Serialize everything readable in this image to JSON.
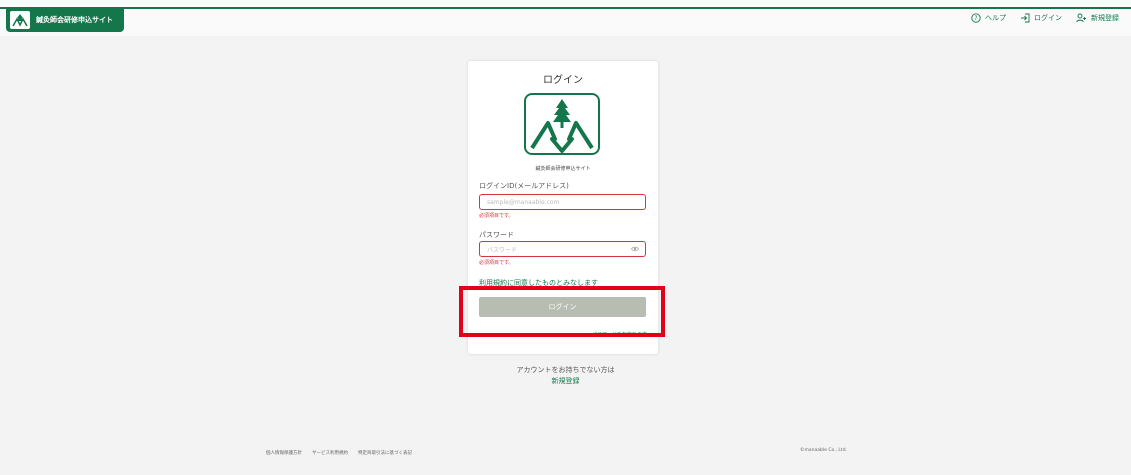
{
  "header": {
    "site_title": "鍼灸師会研修申込サイト",
    "nav": {
      "help": "ヘルプ",
      "login": "ログイン",
      "signup": "新規登録"
    }
  },
  "card": {
    "title": "ログイン",
    "site_name": "鍼灸師会研修申込サイト",
    "login_id_label": "ログインID(メールアドレス)",
    "login_id_placeholder": "sample@manaable.com",
    "login_id_error": "必須項目です。",
    "password_label": "パスワード",
    "password_placeholder": "パスワード",
    "password_error": "必須項目です。",
    "terms_text": "利用規約に同意したものとみなします",
    "login_button": "ログイン",
    "forgot_password": "パスワードをお忘れの方"
  },
  "below_card": {
    "no_account_text": "アカウントをお持ちでない方は",
    "signup_link": "新規登録"
  },
  "footer": {
    "links": [
      "個人情報保護方針",
      "サービス利用規約",
      "特定商取引法に基づく表記"
    ],
    "copyright": "©manaable Co., Ltd."
  },
  "colors": {
    "brand": "#14774c",
    "error": "#d9333f",
    "highlight": "#e3001b",
    "button_disabled": "#b7bdb0"
  },
  "icons": {
    "help": "help-circle-icon",
    "login": "login-icon",
    "signup": "add-user-icon",
    "password_visibility": "eye-icon"
  }
}
